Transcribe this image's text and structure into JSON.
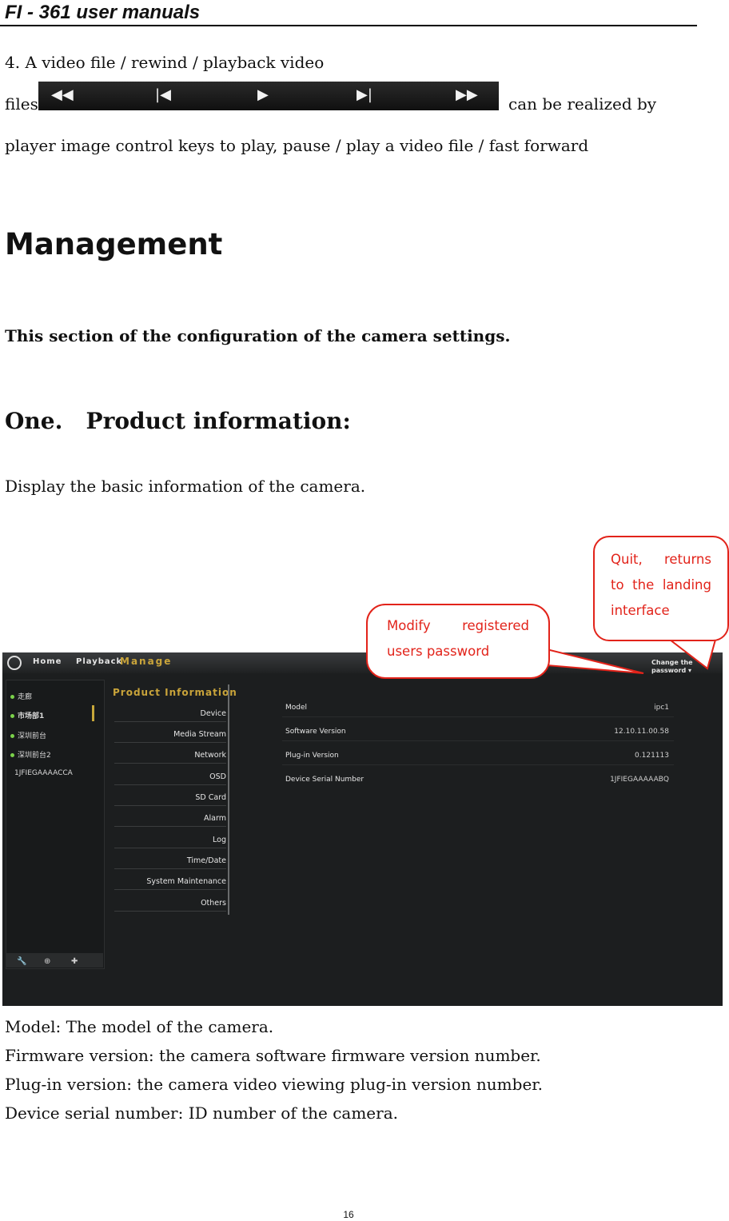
{
  "header": {
    "title": "FI - 361 user manuals"
  },
  "intro": {
    "line1": "4. A video file / rewind / playback video",
    "line2_prefix": "files",
    "line2_suffix": "can be realized by",
    "line3": "player image control keys to play, pause / play a video file / fast forward",
    "controls": [
      "◀◀",
      "|◀",
      "▶",
      "▶|",
      "▶▶"
    ]
  },
  "section": {
    "title": "Management",
    "subtitle": "This section of the configuration of the camera settings.",
    "heading": "One.   Product information:",
    "desc": "Display the basic information of the camera."
  },
  "callouts": {
    "quit": [
      "Quit,    returns",
      "to  the  landing",
      "interface"
    ],
    "modify": [
      "Modify       registered",
      "users     password"
    ]
  },
  "ui": {
    "nav": {
      "home": "Home",
      "playback": "Playback",
      "manage": "Manage"
    },
    "change_password": [
      "Change the",
      "password ▾"
    ],
    "devices": [
      "走廊",
      "市场部1",
      "深圳前台",
      "深圳前台2",
      "1JFIEGAAAACCA"
    ],
    "footer_tools": [
      "🔧",
      "⊕",
      "✚"
    ],
    "menu_title": "Product Information",
    "menu": [
      "Device",
      "Media Stream",
      "Network",
      "OSD",
      "SD Card",
      "Alarm",
      "Log",
      "Time/Date",
      "System Maintenance",
      "Others"
    ],
    "info": [
      {
        "label": "Model",
        "value": "ipc1"
      },
      {
        "label": "Software Version",
        "value": "12.10.11.00.58"
      },
      {
        "label": "Plug-in Version",
        "value": "0.121113"
      },
      {
        "label": "Device Serial Number",
        "value": "1JFIEGAAAAABQ"
      }
    ]
  },
  "notes": [
    "Model: The model of the camera.",
    "Firmware version: the camera software firmware version number.",
    "Plug-in version: the camera video viewing plug-in version number.",
    "Device serial number: ID number of the camera."
  ],
  "page_number": "16"
}
